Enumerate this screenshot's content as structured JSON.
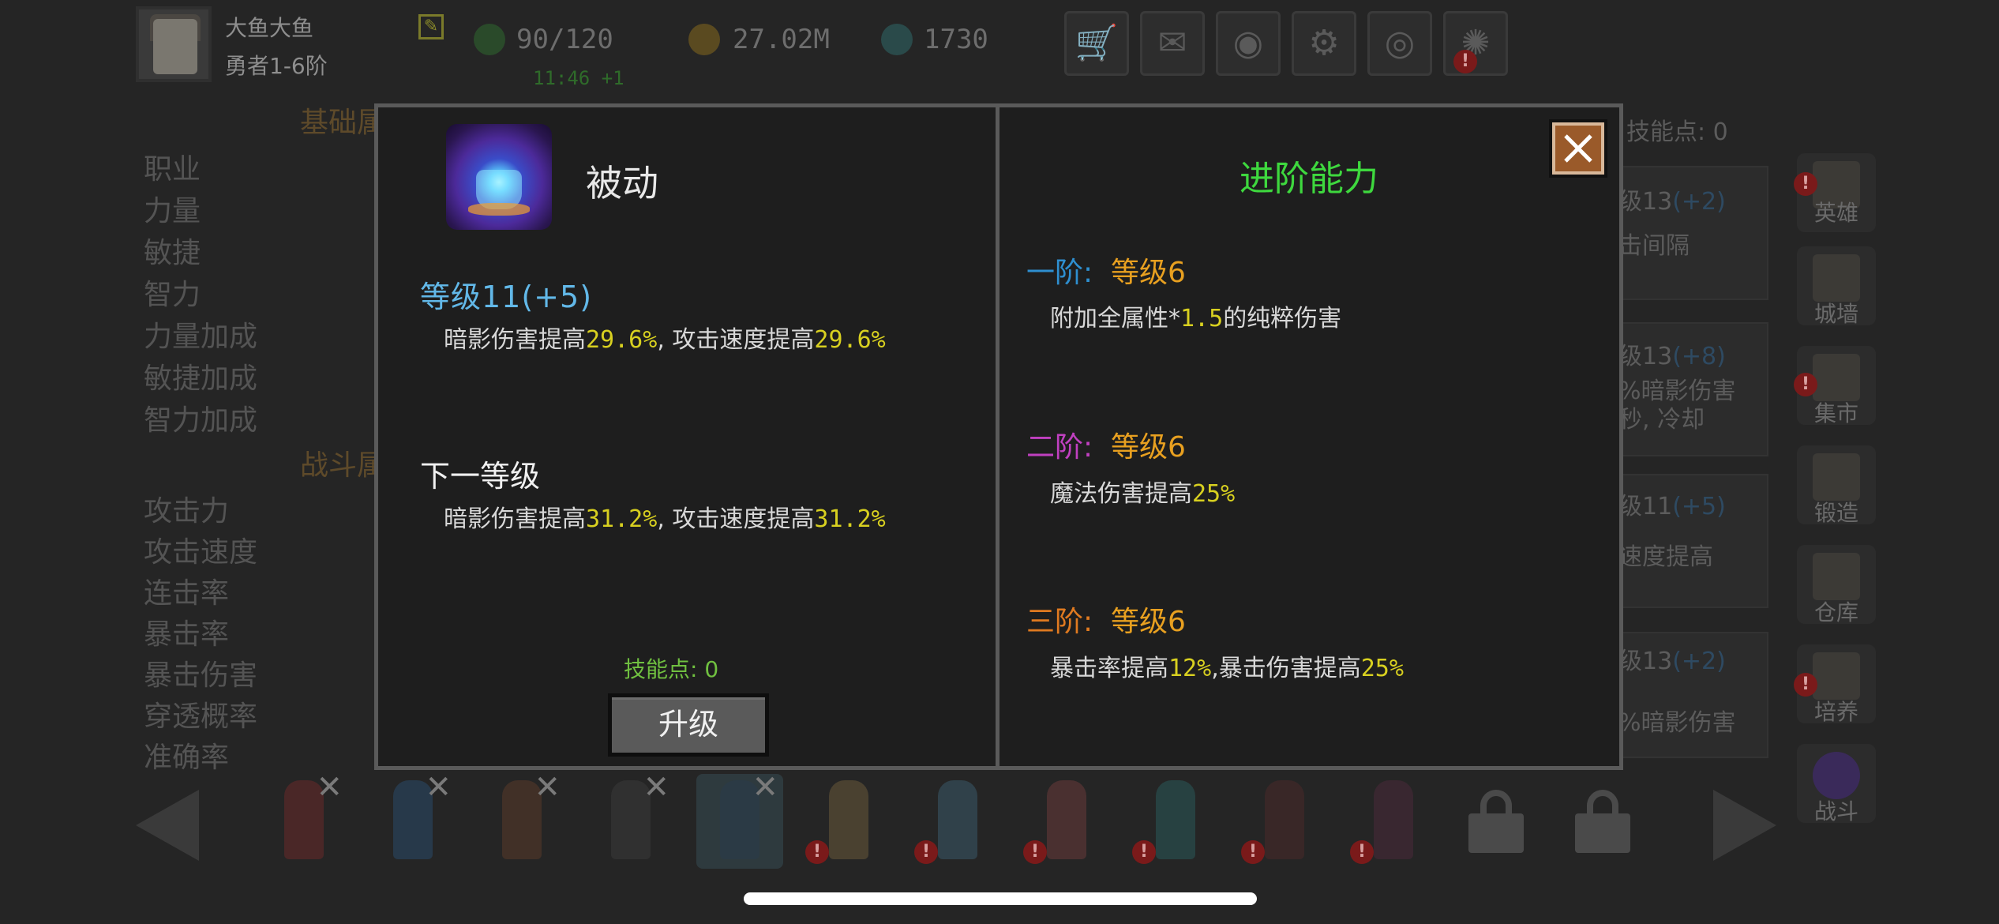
{
  "player": {
    "name": "大鱼大鱼",
    "rank": "勇者1-6阶"
  },
  "resources": {
    "energy": "90/120",
    "energy_timer": "11:46 +1",
    "gold": "27.02M",
    "gems": "1730"
  },
  "top_buttons": [
    "cart-icon",
    "mail-icon",
    "gamepad-icon",
    "gear-icon",
    "color-wheel-icon",
    "fireworks-icon"
  ],
  "background": {
    "basic_section_title": "基础属",
    "battle_section_title": "战斗属",
    "basic_stats": [
      "职业",
      "力量",
      "敏捷",
      "智力",
      "力量加成",
      "敏捷加成",
      "智力加成"
    ],
    "battle_stats": [
      "攻击力",
      "攻击速度",
      "连击率",
      "暴击率",
      "暴击伤害",
      "穿透概率",
      "准确率"
    ],
    "skill_points_partial": "技能点: 0",
    "right_cards": [
      {
        "level": "级13",
        "bonus": "(+2)",
        "line1": "击间隔",
        "line2": ""
      },
      {
        "level": "级13",
        "bonus": "(+8)",
        "line1": "%暗影伤害",
        "line2": "秒, 冷却"
      },
      {
        "level": "级11",
        "bonus": "(+5)",
        "line1": "速度提高",
        "line2": ""
      },
      {
        "level": "级13",
        "bonus": "(+2)",
        "line1": "",
        "line2": "%暗影伤害"
      }
    ],
    "side_menu": [
      "英雄",
      "城墙",
      "集市",
      "锻造",
      "仓库",
      "培养",
      "战斗"
    ]
  },
  "dialog": {
    "skill_name": "被动",
    "current_level": "等级11(+5)",
    "current_desc": {
      "p1": "暗影伤害提高",
      "v1": "29.6%",
      "p2": ", 攻击速度提高",
      "v2": "29.6%"
    },
    "next_level_title": "下一等级",
    "next_desc": {
      "p1": "暗影伤害提高",
      "v1": "31.2%",
      "p2": ", 攻击速度提高",
      "v2": "31.2%"
    },
    "skill_points_label": "技能点: 0",
    "upgrade_button": "升级",
    "advanced_title": "进阶能力",
    "tiers": [
      {
        "name": "一阶:",
        "level": "等级6",
        "p1": "附加全属性*",
        "v1": "1.5",
        "p2": "的纯粹伤害",
        "v2": "",
        "p3": "",
        "v3": "",
        "color": "#2e8fd0"
      },
      {
        "name": "二阶:",
        "level": "等级6",
        "p1": "魔法伤害提高",
        "v1": "25%",
        "p2": "",
        "v2": "",
        "p3": "",
        "v3": "",
        "color": "#c040c0"
      },
      {
        "name": "三阶:",
        "level": "等级6",
        "p1": "暴击率提高",
        "v1": "12%",
        "p2": ",暴击伤害提高",
        "v2": "25%",
        "p3": "",
        "v3": "",
        "color": "#e07a20"
      }
    ],
    "level_color": "#e8a020",
    "close_icon": "close-icon"
  },
  "colors": {
    "accent_green": "#3ed83e",
    "value_yellow": "#d8d020",
    "level_blue": "#62b8e8"
  }
}
